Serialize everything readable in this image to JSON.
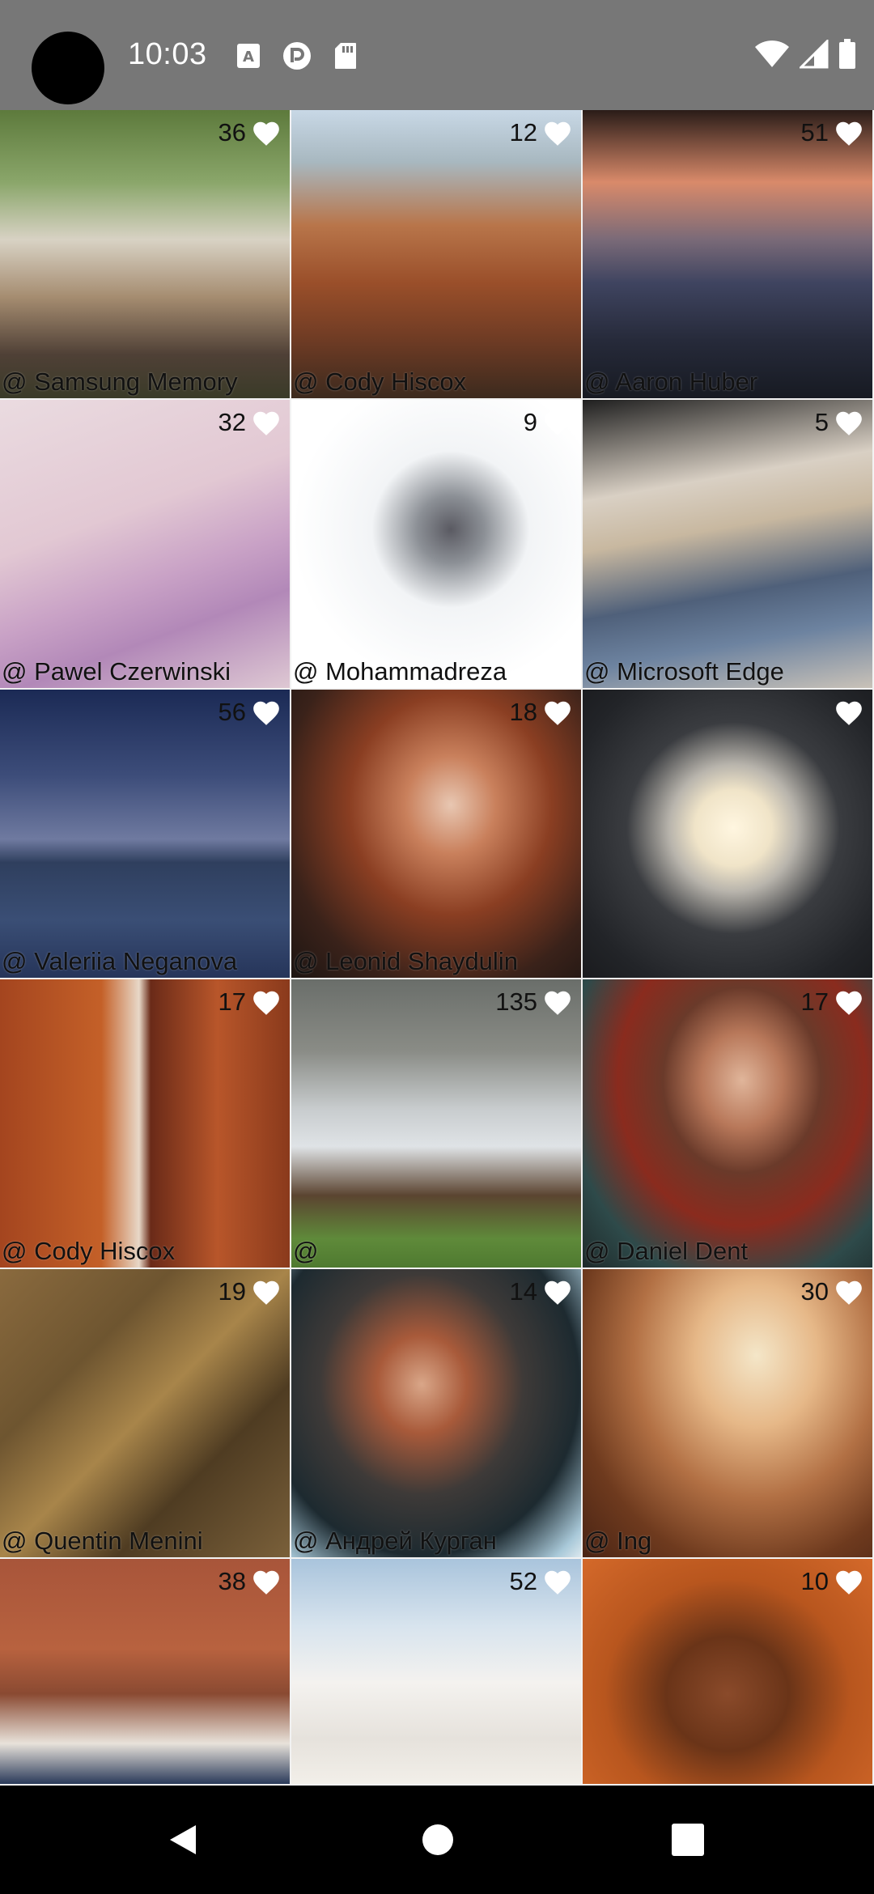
{
  "status_bar": {
    "time": "10:03",
    "notification_icons": [
      "font-a-icon",
      "pocket-casts-icon",
      "sd-card-icon"
    ],
    "system_icons": [
      "wifi-icon",
      "signal-icon",
      "battery-icon"
    ]
  },
  "grid": {
    "tiles": [
      {
        "likes": "36",
        "author": "@ Samsung Memory"
      },
      {
        "likes": "12",
        "author": "@ Cody Hiscox"
      },
      {
        "likes": "51",
        "author": "@ Aaron Huber"
      },
      {
        "likes": "32",
        "author": "@ Pawel Czerwinski"
      },
      {
        "likes": "9",
        "author": "@ Mohammadreza"
      },
      {
        "likes": "5",
        "author": "@ Microsoft Edge"
      },
      {
        "likes": "56",
        "author": "@ Valeriia Neganova"
      },
      {
        "likes": "18",
        "author": "@ Leonid Shaydulin"
      },
      {
        "likes": "",
        "author": ""
      },
      {
        "likes": "17",
        "author": "@ Cody Hiscox"
      },
      {
        "likes": "135",
        "author": "@"
      },
      {
        "likes": "17",
        "author": "@ Daniel Dent"
      },
      {
        "likes": "19",
        "author": "@ Quentin Menini"
      },
      {
        "likes": "14",
        "author": "@ Андрей Курган"
      },
      {
        "likes": "30",
        "author": "@ Ing"
      },
      {
        "likes": "38",
        "author": ""
      },
      {
        "likes": "52",
        "author": ""
      },
      {
        "likes": "10",
        "author": ""
      }
    ]
  },
  "nav_bar": {
    "buttons": [
      "back-icon",
      "home-icon",
      "recents-icon"
    ]
  }
}
